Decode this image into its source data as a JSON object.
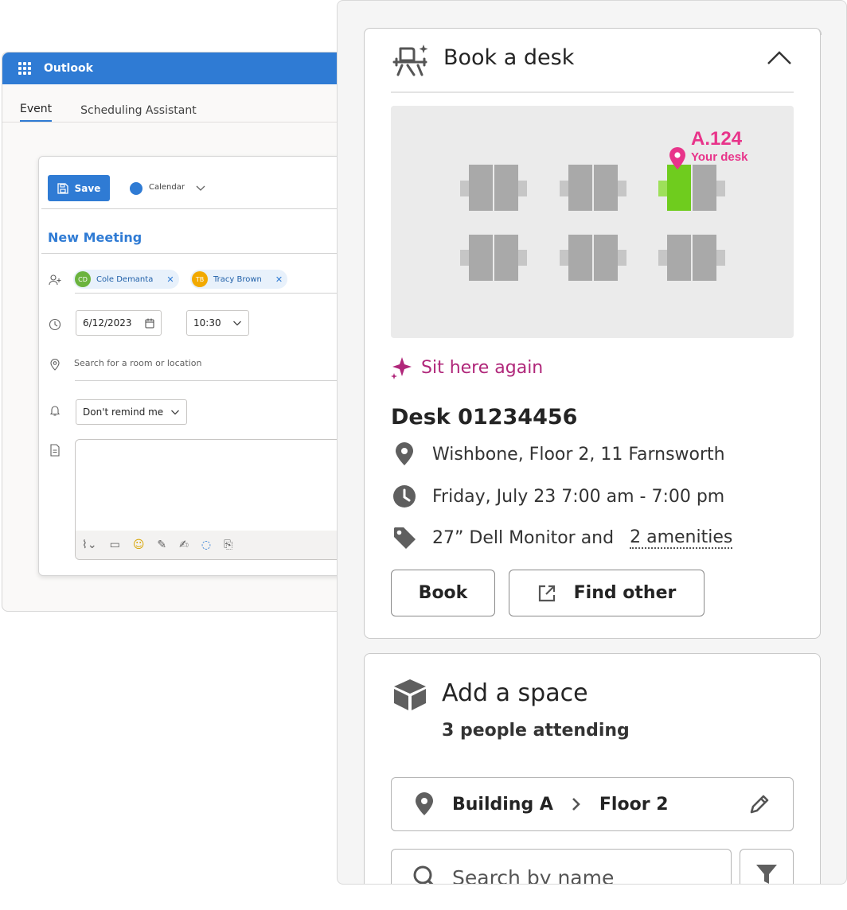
{
  "outlook": {
    "app_title": "Outlook",
    "tabs": [
      {
        "label": "Event",
        "active": true
      },
      {
        "label": "Scheduling Assistant",
        "active": false
      }
    ],
    "save_label": "Save",
    "calendar_label": "Calendar",
    "meeting_title": "New Meeting",
    "attendees": [
      {
        "initials": "CD",
        "name": "Cole Demanta",
        "color": "#6bb33e"
      },
      {
        "initials": "TB",
        "name": "Tracy Brown",
        "color": "#f2a900"
      }
    ],
    "date_value": "6/12/2023",
    "time_value": "10:30",
    "location_placeholder": "Search for a room or location",
    "reminder_value": "Don't remind me",
    "accent_color": "#2f7bd4"
  },
  "desk_panel": {
    "title": "Book a desk",
    "map": {
      "selected_desk_label": "A.124",
      "selected_desk_caption": "Your desk",
      "highlight_color": "#6fcc1e",
      "pin_color": "#e8348a"
    },
    "sit_again_label": "Sit here again",
    "desk_name": "Desk 01234456",
    "location": "Wishbone, Floor 2, 11 Farnsworth",
    "time": "Friday, July 23 7:00 am - 7:00 pm",
    "amenities_prefix": "27” Dell Monitor and",
    "amenities_link": "2 amenities",
    "book_label": "Book",
    "find_other_label": "Find other"
  },
  "space_panel": {
    "title": "Add a space",
    "subtitle": "3 people attending",
    "building": "Building A",
    "floor": "Floor 2",
    "search_placeholder": "Search by name"
  }
}
